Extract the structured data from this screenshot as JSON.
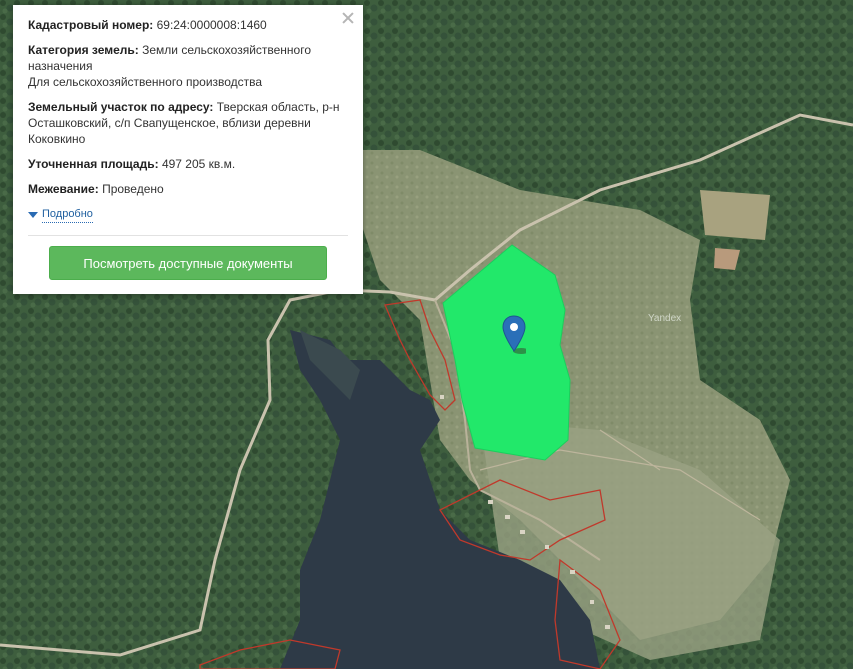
{
  "popup": {
    "cadastral_label": "Кадастровый номер:",
    "cadastral_value": "69:24:0000008:1460",
    "category_label": "Категория земель:",
    "category_value": "Земли сельскохозяйственного назначения",
    "category_use": "Для сельскохозяйственного производства",
    "address_label": "Земельный участок по адресу:",
    "address_value": "Тверская область, р-н Осташковский, с/п Свапущенское, вблизи деревни Коковкино",
    "area_label": "Уточненная площадь:",
    "area_value": "497 205 кв.м.",
    "survey_label": "Межевание:",
    "survey_value": "Проведено",
    "more_label": "Подробно",
    "docs_button": "Посмотреть доступные документы",
    "close_icon": "close-icon"
  },
  "map": {
    "watermark": "Yandex",
    "parcel_color": "#22e86a",
    "boundary_color": "#c0392b",
    "marker_color": "#2a6fb8",
    "marker_icon": "map-pin-icon"
  }
}
